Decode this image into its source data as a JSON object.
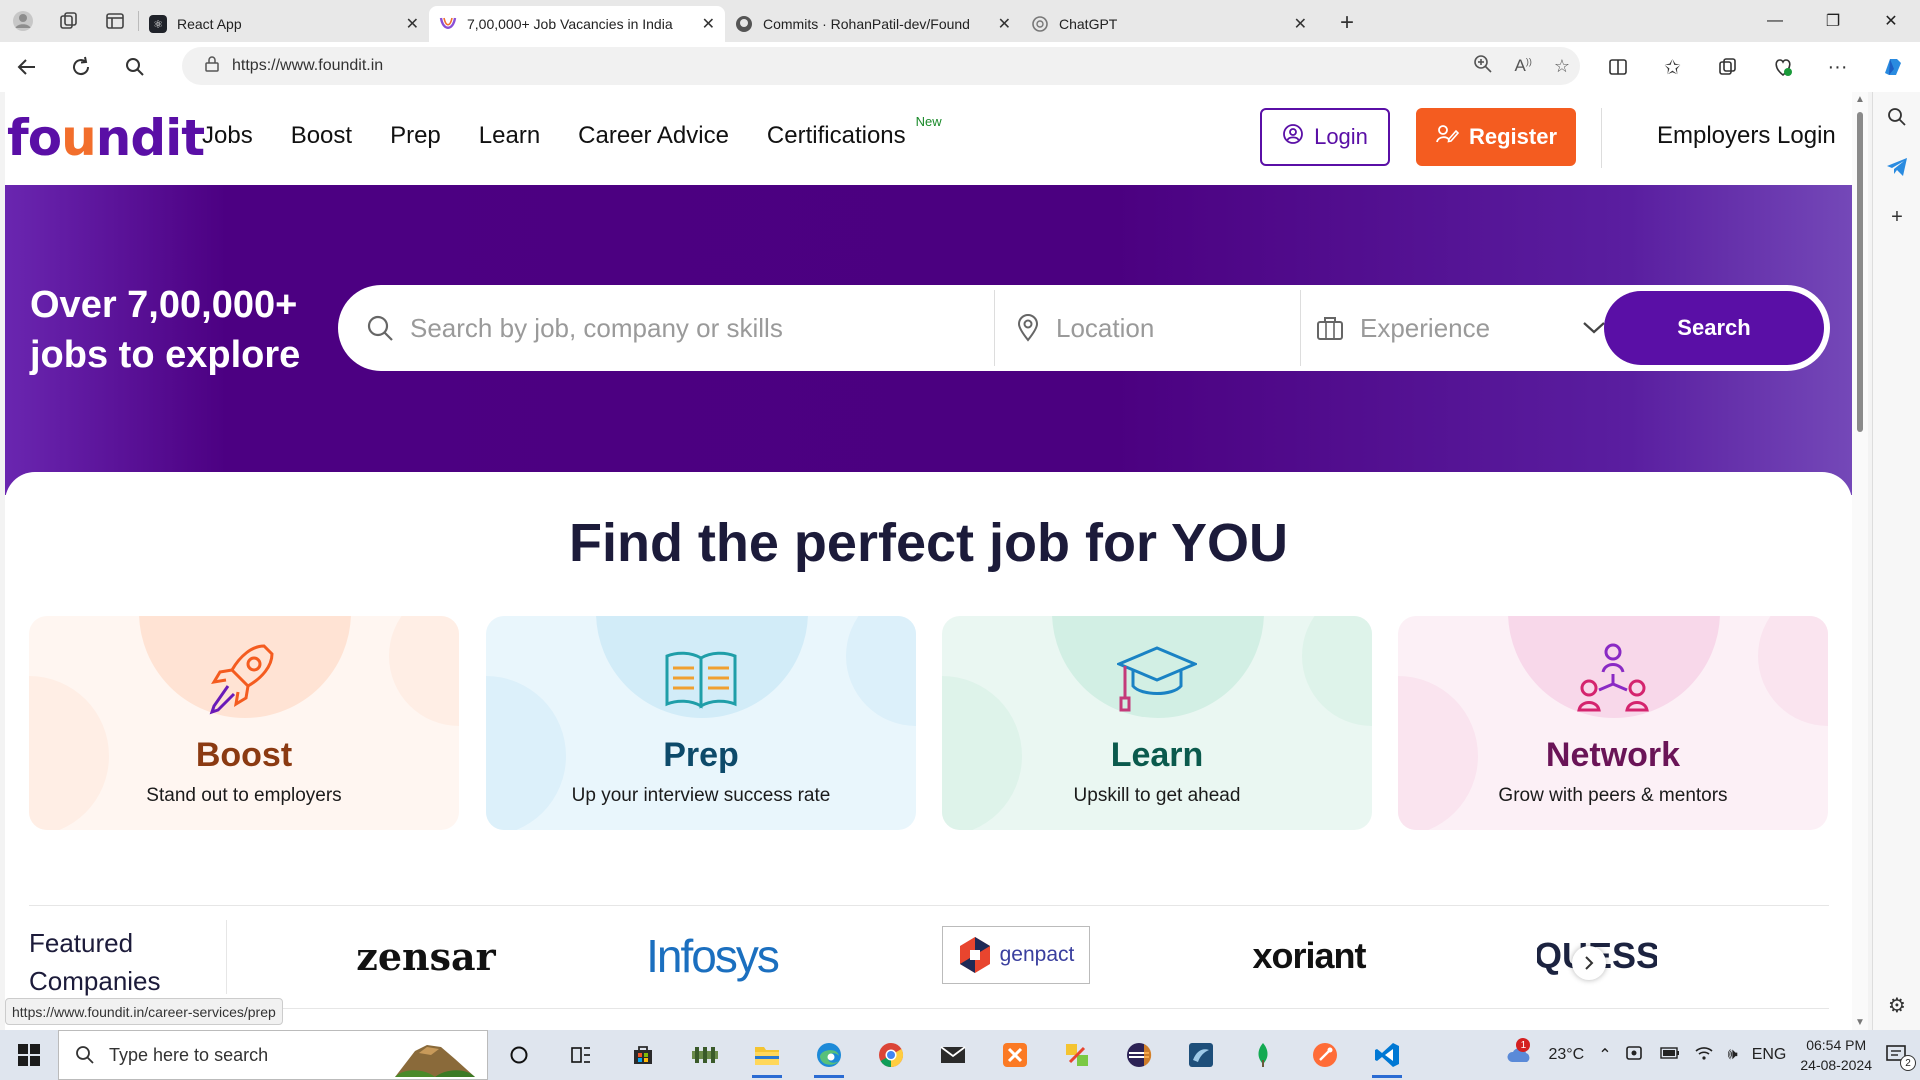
{
  "browser": {
    "tabs": [
      {
        "label": "React App",
        "active": false,
        "icon": "react-icon"
      },
      {
        "label": "7,00,000+ Job Vacancies in India",
        "active": true,
        "icon": "foundit-icon"
      },
      {
        "label": "Commits · RohanPatil-dev/Found",
        "active": false,
        "icon": "github-icon"
      },
      {
        "label": "ChatGPT",
        "active": false,
        "icon": "chatgpt-icon"
      }
    ],
    "url": "https://www.foundit.in",
    "status_link": "https://www.foundit.in/career-services/prep"
  },
  "header": {
    "logo_parts": [
      "fo",
      "u",
      "ndit"
    ],
    "nav": [
      "Jobs",
      "Boost",
      "Prep",
      "Learn",
      "Career Advice",
      "Certifications"
    ],
    "new_badge": "New",
    "login": "Login",
    "register": "Register",
    "employers": "Employers Login"
  },
  "hero": {
    "title_line1": "Over 7,00,000+",
    "title_line2": "jobs to explore",
    "search_placeholder": "Search by job, company or skills",
    "location_placeholder": "Location",
    "experience_placeholder": "Experience",
    "search_button": "Search"
  },
  "main": {
    "title": "Find the perfect job for YOU",
    "cards": [
      {
        "title": "Boost",
        "subtitle": "Stand out to employers",
        "icon": "rocket-icon",
        "color": "#8b3a12"
      },
      {
        "title": "Prep",
        "subtitle": "Up your interview success rate",
        "icon": "book-icon",
        "color": "#0d4a6a"
      },
      {
        "title": "Learn",
        "subtitle": "Upskill to get ahead",
        "icon": "graduation-cap-icon",
        "color": "#0b5a4d"
      },
      {
        "title": "Network",
        "subtitle": "Grow with peers & mentors",
        "icon": "network-icon",
        "color": "#6a1457"
      }
    ],
    "featured_label_line1": "Featured",
    "featured_label_line2": "Companies",
    "companies": [
      "zensar",
      "Infosys",
      "genpact",
      "xoriant",
      "QUESS"
    ]
  },
  "taskbar": {
    "search_placeholder": "Type here to search",
    "weather": "23°C",
    "language": "ENG",
    "time": "06:54 PM",
    "date": "24-08-2024",
    "notif_count": "2",
    "weather_badge": "1"
  }
}
